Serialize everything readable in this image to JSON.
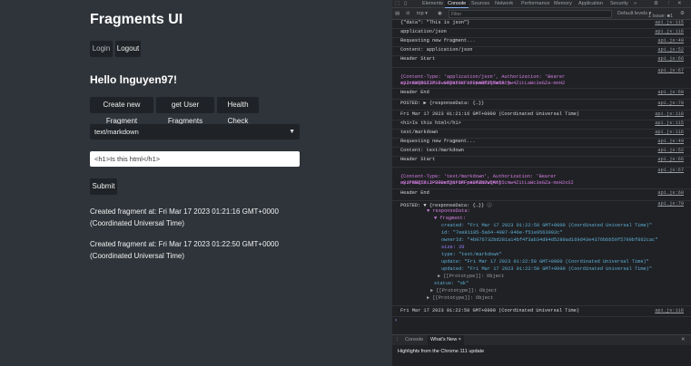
{
  "app": {
    "title": "Fragments UI",
    "login_label": "Login",
    "logout_label": "Logout",
    "greeting": "Hello lnguyen97!",
    "create_label": "Create new Fragment",
    "get_label": "get User Fragments",
    "health_label": "Health Check",
    "type_select": "text/markdown",
    "content_input": "<h1>Is this html</h1>",
    "submit_label": "Submit",
    "status_messages": [
      "Created fragment at: Fri Mar 17 2023 01:21:16 GMT+0000 (Coordinated Universal Time)",
      "Created fragment at: Fri Mar 17 2023 01:22:50 GMT+0000 (Coordinated Universal Time)"
    ]
  },
  "devtools": {
    "tabs": [
      "Elements",
      "Console",
      "Sources",
      "Network",
      "Performance",
      "Memory",
      "Application",
      "Security",
      "»"
    ],
    "active_tab": "Console",
    "context": "top ▾",
    "filter_placeholder": "Filter",
    "levels": "Default levels ▾",
    "issues": "1 Issue: ■1",
    "logs": [
      {
        "msg": "{\"data\": \"This is json\"}",
        "src": "api.js:115"
      },
      {
        "msg": "application/json",
        "src": "api.js:116"
      },
      {
        "msg": "Requesting new fragment...",
        "src": "api.js:49"
      },
      {
        "msg": "Content:  application/json",
        "src": "api.js:52"
      },
      {
        "msg": "Header Start",
        "src": "api.js:66"
      },
      {
        "msg": "{Content-Type: 'application/json', Authorization: 'Bearer eyJraWQiOiJPSFwvdjNrOXFreU4wNDVQMmt5cmw4ZitLaWc3eGZa-mxH2",
        "msg2": "xSInRzPRGZIX-I-0B0e53cF1PFpABfZb7w5A'}",
        "src": "api.js:67"
      },
      {
        "msg": "Header End",
        "src": "api.js:68"
      },
      {
        "msg": "POSTED:  ▶ {responseData: {…}}",
        "src": "api.js:70"
      },
      {
        "msg": "Fri Mar 17 2023 01:21:16 GMT+0000 (Coordinated Universal Time)",
        "src": "api.js:118"
      },
      {
        "msg": "<h1>Is this html</h1>",
        "src": "api.js:115"
      },
      {
        "msg": "text/markdown",
        "src": "api.js:116"
      },
      {
        "msg": "Requesting new fragment...",
        "src": "api.js:49"
      },
      {
        "msg": "Content:  text/markdown",
        "src": "api.js:52"
      },
      {
        "msg": "Header Start",
        "src": "api.js:66"
      },
      {
        "msg": "{Content-Type: 'text/markdown', Authorization: 'Bearer eyJraWQiOiJPSFwvdjNrOXFreU4wNDVQMmt5cmw4ZitLaWc3eGZa-mxH2xSI",
        "msg2": "nRzPRGZIX-I-0B0e53cF1PFpABfZb7w5A'}",
        "src": "api.js:67"
      },
      {
        "msg": "Header End",
        "src": "api.js:68"
      },
      {
        "msg": "POSTED:  ▼ {responseData: {…}} ⓘ",
        "src": "api.js:70"
      }
    ],
    "expanded": [
      "▼ responseData:",
      "▼ fragment:",
      "created: \"Fri Mar 17 2023 01:22:50 GMT+0000 (Coordinated Universal Time)\"",
      "id: \"7ee81185-5a64-4087-946e-f51e9563992c\"",
      "ownerId: \"4b976732bd281a14bf4f3ab34d94d5280ad169d43e4376bbb59f5799bf862cac\"",
      "size: 20",
      "type: \"text/markdown\"",
      "update: \"Fri Mar 17 2023 01:22:50 GMT+0000 (Coordinated Universal Time)\"",
      "updated: \"Fri Mar 17 2023 01:22:50 GMT+0000 (Coordinated Universal Time)\"",
      "▶ [[Prototype]]: Object",
      "status: \"ok\"",
      "▶ [[Prototype]]: Object",
      "▶ [[Prototype]]: Object"
    ],
    "last_log": {
      "msg": "Fri Mar 17 2023 01:22:50 GMT+0000 (Coordinated Universal Time)",
      "src": "api.js:118"
    },
    "prompt": "›",
    "drawer_tabs": [
      "Console",
      "What's New ×"
    ],
    "highlights": "Highlights from the Chrome 111 update"
  }
}
